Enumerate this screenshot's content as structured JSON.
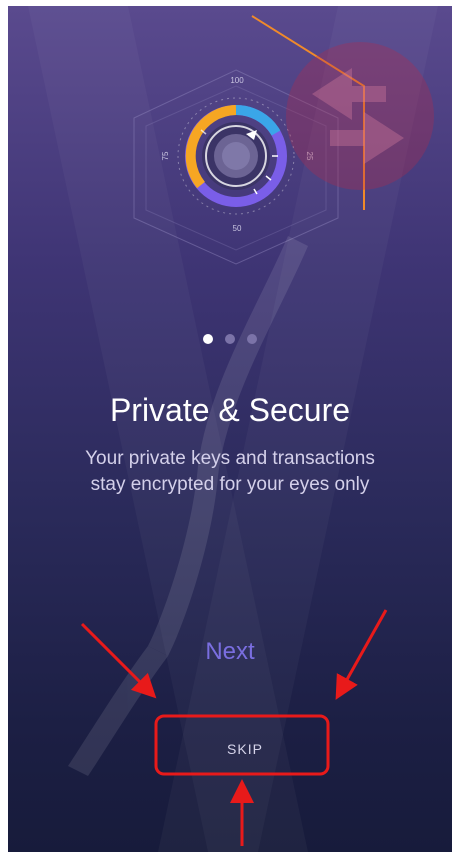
{
  "onboarding": {
    "gauge_labels": {
      "top": "100",
      "right": "25",
      "bottom": "50",
      "left": "75"
    },
    "pager": {
      "total": 3,
      "active_index": 0
    },
    "title": "Private & Secure",
    "subtitle_line1": "Your private keys and transactions",
    "subtitle_line2": "stay encrypted for your eyes only",
    "next_label": "Next",
    "skip_label": "SKIP"
  },
  "colors": {
    "accent": "#7a6ee0",
    "annotation": "#e81a1a",
    "gauge_orange": "#f6a623",
    "gauge_blue": "#3aa6e8",
    "gauge_purple": "#7a5ee8"
  }
}
